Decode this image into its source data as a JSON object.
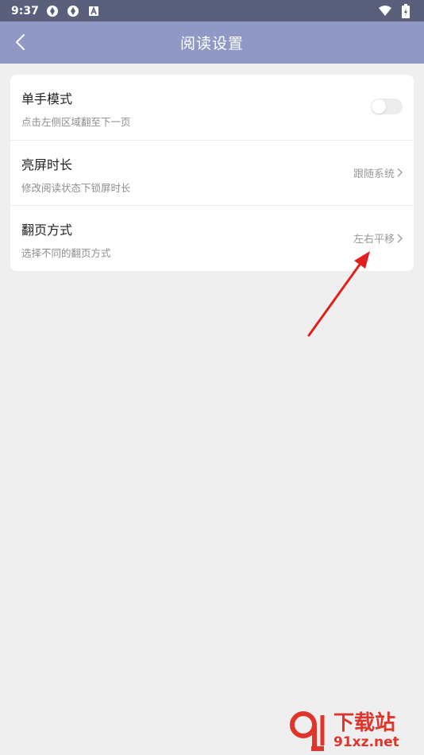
{
  "status_bar": {
    "time": "9:37"
  },
  "header": {
    "title": "阅读设置"
  },
  "settings": [
    {
      "title": "单手模式",
      "subtitle": "点击左侧区域翻至下一页",
      "type": "toggle",
      "enabled": false
    },
    {
      "title": "亮屏时长",
      "subtitle": "修改阅读状态下锁屏时长",
      "type": "value",
      "value": "跟随系统"
    },
    {
      "title": "翻页方式",
      "subtitle": "选择不同的翻页方式",
      "type": "value",
      "value": "左右平移"
    }
  ],
  "watermark": {
    "brand": "下载站",
    "site": "91xz.net"
  },
  "colors": {
    "app_bar": "#9099c6",
    "status_bar": "#5a5f7b",
    "background": "#efefef",
    "annotation_arrow": "#e02020",
    "watermark": "#e0352b"
  }
}
